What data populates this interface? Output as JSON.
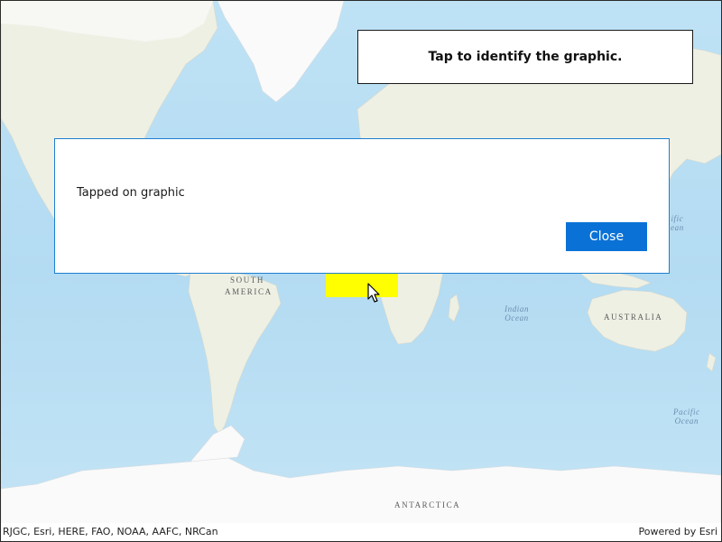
{
  "map": {
    "labels": {
      "south_america_1": "SOUTH",
      "south_america_2": "AMERICA",
      "australia": "AUSTRALIA",
      "antarctica": "ANTARCTICA",
      "indian_ocean_1": "Indian",
      "indian_ocean_2": "Ocean",
      "pacific_ocean_1": "Pacific",
      "pacific_ocean_2": "Ocean",
      "pacific_ocean_top_1": "ific",
      "pacific_ocean_top_2": "ean"
    },
    "colors": {
      "water": "#b7ddf3",
      "land": "#eef0e4",
      "ice": "#fafafa",
      "graphic": "#ffff00"
    }
  },
  "instruction": {
    "text": "Tap to identify the graphic."
  },
  "dialog": {
    "message": "Tapped on graphic",
    "close_label": "Close",
    "accent": "#0a72d6"
  },
  "attribution": {
    "text": "RJGC, Esri, HERE, FAO, NOAA, AAFC, NRCan",
    "powered_by": "Powered by Esri"
  }
}
